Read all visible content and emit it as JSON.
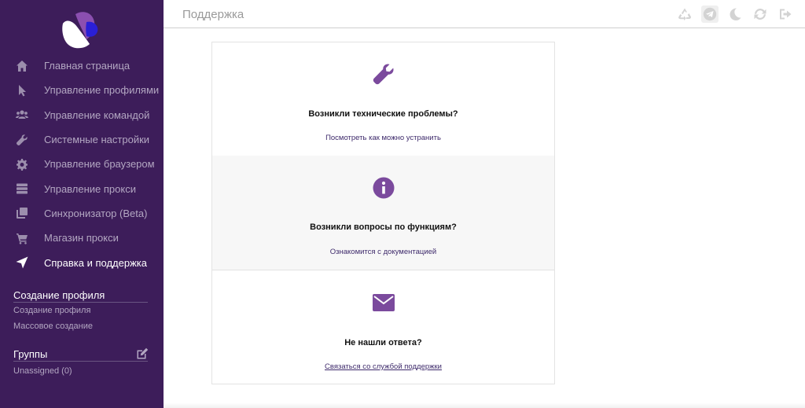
{
  "sidebar": {
    "nav": [
      {
        "label": "Главная страница",
        "icon": "home-icon",
        "active": false
      },
      {
        "label": "Управление профилями",
        "icon": "pointer-icon",
        "active": false
      },
      {
        "label": "Управление командой",
        "icon": "users-icon",
        "active": false
      },
      {
        "label": "Системные настройки",
        "icon": "wrench-icon",
        "active": false
      },
      {
        "label": "Управление браузером",
        "icon": "gear-icon",
        "active": false
      },
      {
        "label": "Управление прокси",
        "icon": "server-icon",
        "active": false
      },
      {
        "label": "Синхронизатор (Beta)",
        "icon": "sync-copy-icon",
        "active": false
      },
      {
        "label": "Магазин прокси",
        "icon": "cart-icon",
        "active": false
      },
      {
        "label": "Справка и поддержка",
        "icon": "send-icon",
        "active": true
      }
    ],
    "create_section": {
      "title": "Создание профиля",
      "links": [
        "Создание профиля",
        "Массовое создание"
      ]
    },
    "groups_section": {
      "title": "Группы",
      "items": [
        "Unassigned (0)"
      ]
    }
  },
  "header": {
    "title": "Поддержка",
    "icons": [
      "recycle-icon",
      "telegram-icon",
      "moon-icon",
      "refresh-icon",
      "logout-icon"
    ]
  },
  "cards": [
    {
      "icon": "wrench-icon",
      "title": "Возникли технические проблемы?",
      "link": "Посмотреть как можно устранить"
    },
    {
      "icon": "info-icon",
      "title": "Возникли вопросы по функциям?",
      "link": "Ознакомится с документацией"
    },
    {
      "icon": "envelope-icon",
      "title": "Не нашли ответа?",
      "link": "Связаться со службой поддержки"
    }
  ],
  "colors": {
    "sidebar_bg": "#3d1d5a",
    "accent": "#7b4a9d",
    "card_alt_bg": "#f7f7f7"
  }
}
